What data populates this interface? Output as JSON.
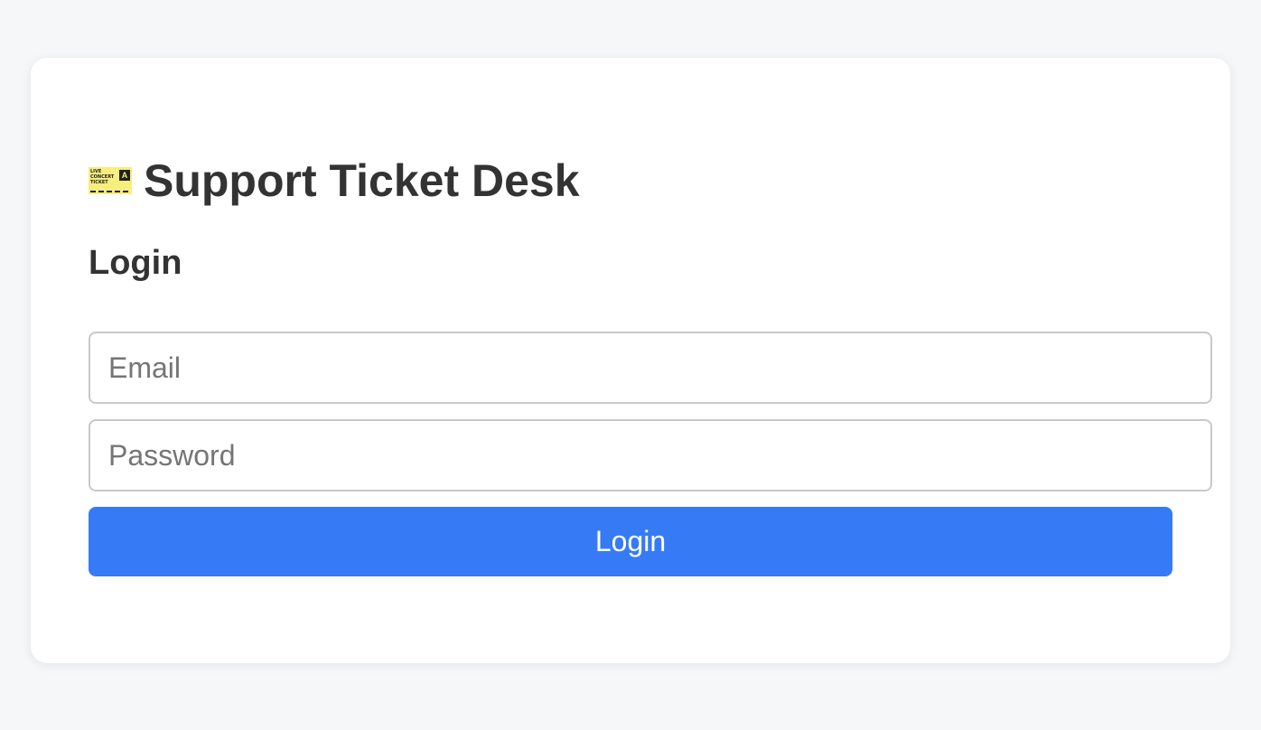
{
  "app": {
    "title": "Support Ticket Desk",
    "logo_icon": "ticket-icon"
  },
  "login_form": {
    "heading": "Login",
    "email_placeholder": "Email",
    "email_value": "",
    "password_placeholder": "Password",
    "password_value": "",
    "submit_label": "Login"
  },
  "ticket_icon_art": {
    "line1": "LIVE",
    "line2": "CONCERT",
    "line3": "TICKET",
    "zone": "A"
  },
  "colors": {
    "page_background": "#f6f7f9",
    "card_background": "#ffffff",
    "text": "#333333",
    "primary_button": "#367bf5",
    "input_border": "#c9c9c9"
  }
}
